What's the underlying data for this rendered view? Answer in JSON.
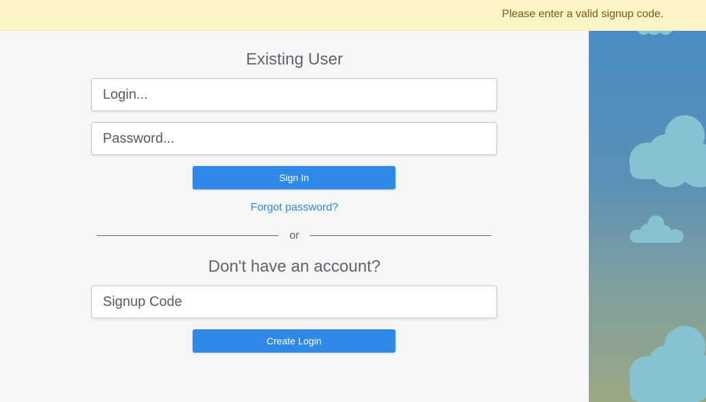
{
  "alert": {
    "message": "Please enter a valid signup code."
  },
  "existing_user": {
    "heading": "Existing User",
    "login_placeholder": "Login...",
    "password_placeholder": "Password...",
    "sign_in_label": "Sign In",
    "forgot_password_label": "Forgot password?"
  },
  "divider": {
    "label": "or"
  },
  "new_user": {
    "heading": "Don't have an account?",
    "signup_code_placeholder": "Signup Code",
    "create_login_label": "Create Login"
  },
  "decor": {
    "image": "sky-with-clouds"
  },
  "colors": {
    "accent": "#2f89e6",
    "alert_bg": "#fdf3c7",
    "alert_text": "#7a5a14",
    "sky_top": "#4a8cc4",
    "sky_bottom": "#9aa784",
    "cloud": "#86c2d2"
  }
}
